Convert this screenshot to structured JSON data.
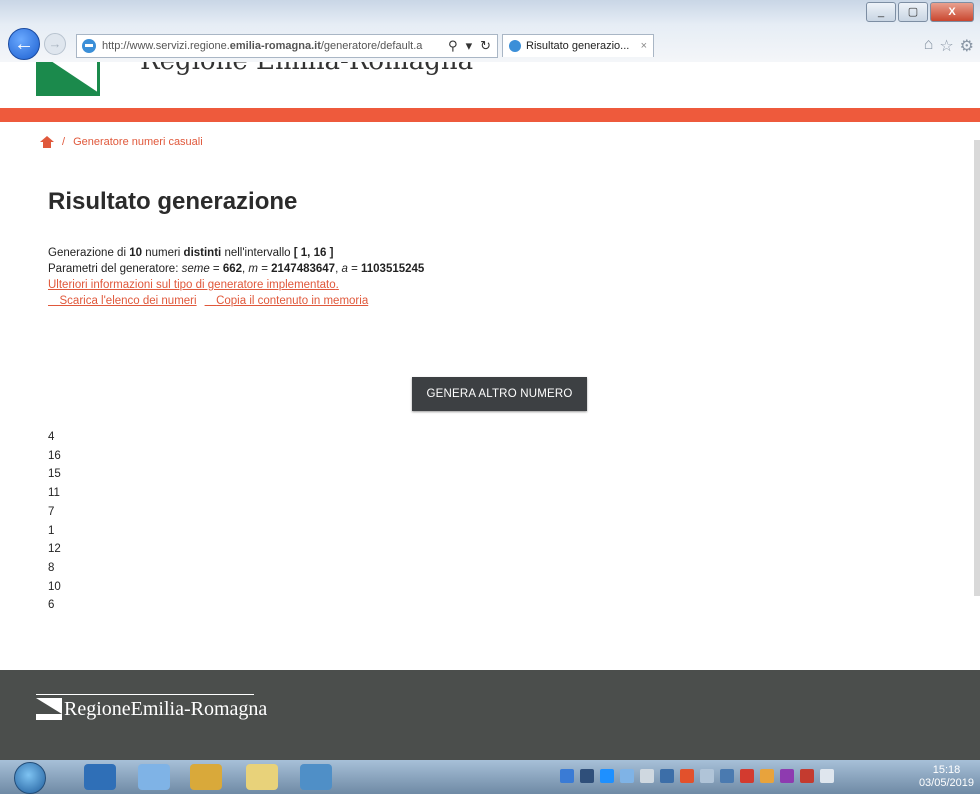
{
  "browser": {
    "url_prefix": "http://www.servizi.regione.",
    "url_host": "emilia-romagna.it",
    "url_suffix": "/generatore/default.a",
    "tab_title": "Risultato generazio...",
    "window_buttons": [
      "_",
      "▢",
      "X"
    ]
  },
  "header": {
    "site_title": "Regione Emilia-Romagna"
  },
  "breadcrumb": {
    "separator": "/",
    "current": "Generatore numeri casuali"
  },
  "main": {
    "title": "Risultato generazione",
    "line1": {
      "t1": "Generazione di ",
      "count": "10",
      "t2": " numeri ",
      "distinct": "distinti",
      "t3": " nell'intervallo ",
      "interval": "[ 1, 16 ]"
    },
    "line2": {
      "t1": "Parametri del generatore: ",
      "seed_label": "seme",
      "eq1": " = ",
      "seed": "662",
      "sep1": ", ",
      "m_label": "m",
      "eq2": " = ",
      "m": "2147483647",
      "sep2": ", ",
      "a_label": "a",
      "eq3": " = ",
      "a": "1103515245"
    },
    "info_link": "Ulteriori informazioni sul tipo di generatore implementato",
    "info_link_suffix": ".",
    "download_link": "Scarica l'elenco dei numeri",
    "copy_link": "Copia il contenuto in memoria",
    "generate_button": "GENERA ALTRO NUMERO",
    "numbers": [
      "4",
      "16",
      "15",
      "11",
      "7",
      "1",
      "12",
      "8",
      "10",
      "6"
    ]
  },
  "footer": {
    "logo_text": "RegioneEmilia-Romagna"
  },
  "taskbar": {
    "time": "15:18",
    "date": "03/05/2019"
  }
}
